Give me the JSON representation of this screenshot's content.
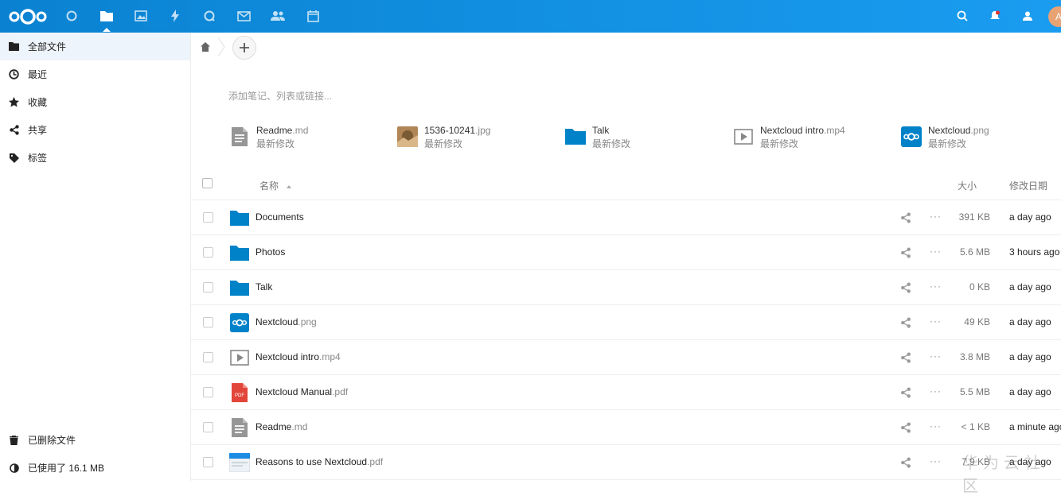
{
  "colors": {
    "header_bg": "#0a82d1",
    "folder": "#0082c9",
    "pdf": "#e2463a",
    "avatar": "#e8a274"
  },
  "header": {
    "apps": [
      "dashboard-icon",
      "files-icon",
      "photos-icon",
      "activity-icon",
      "talk-icon",
      "mail-icon",
      "contacts-icon",
      "calendar-icon"
    ],
    "avatar_initial": "A"
  },
  "sidebar": {
    "items": [
      {
        "label": "全部文件",
        "icon": "folder-icon"
      },
      {
        "label": "最近",
        "icon": "clock-icon"
      },
      {
        "label": "收藏",
        "icon": "star-icon"
      },
      {
        "label": "共享",
        "icon": "share-icon"
      },
      {
        "label": "标签",
        "icon": "tag-icon"
      }
    ],
    "trash_label": "已删除文件",
    "quota_label": "已使用了 16.1 MB"
  },
  "notes": {
    "placeholder": "添加笔记、列表或链接..."
  },
  "recent": [
    {
      "base": "Readme",
      "ext": ".md",
      "sub": "最新修改",
      "icon": "text-file-icon"
    },
    {
      "base": "1536-10241",
      "ext": ".jpg",
      "sub": "最新修改",
      "icon": "image-thumbnail"
    },
    {
      "base": "Talk",
      "ext": "",
      "sub": "最新修改",
      "icon": "folder-icon"
    },
    {
      "base": "Nextcloud intro",
      "ext": ".mp4",
      "sub": "最新修改",
      "icon": "video-icon"
    },
    {
      "base": "Nextcloud",
      "ext": ".png",
      "sub": "最新修改",
      "icon": "nextcloud-logo-icon"
    }
  ],
  "table": {
    "col_name": "名称",
    "col_size": "大小",
    "col_modified": "修改日期",
    "rows": [
      {
        "base": "Documents",
        "ext": "",
        "size": "391 KB",
        "modified": "a day ago"
      },
      {
        "base": "Photos",
        "ext": "",
        "size": "5.6 MB",
        "modified": "3 hours ago"
      },
      {
        "base": "Talk",
        "ext": "",
        "size": "0 KB",
        "modified": "a day ago"
      },
      {
        "base": "Nextcloud",
        "ext": ".png",
        "size": "49 KB",
        "modified": "a day ago"
      },
      {
        "base": "Nextcloud intro",
        "ext": ".mp4",
        "size": "3.8 MB",
        "modified": "a day ago"
      },
      {
        "base": "Nextcloud Manual",
        "ext": ".pdf",
        "size": "5.5 MB",
        "modified": "a day ago"
      },
      {
        "base": "Readme",
        "ext": ".md",
        "size": "< 1 KB",
        "modified": "a minute ago"
      },
      {
        "base": "Reasons to use Nextcloud",
        "ext": ".pdf",
        "size": "7.9 KB",
        "modified": "a day ago"
      }
    ]
  },
  "watermark": "华为云社区"
}
